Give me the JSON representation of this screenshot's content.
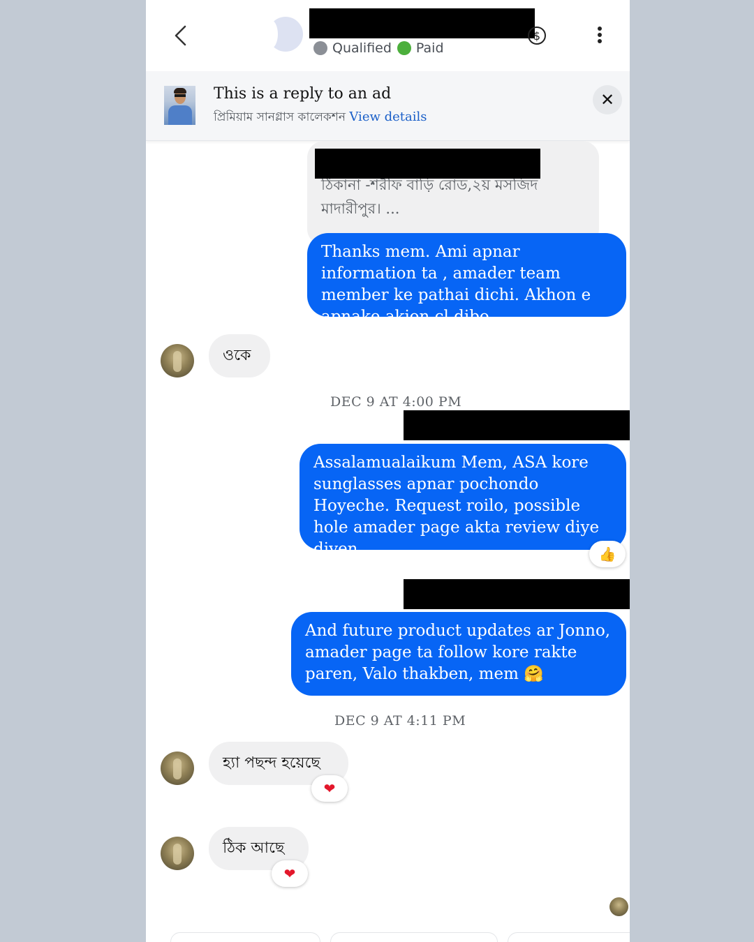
{
  "header": {
    "status": [
      {
        "label": "Qualified",
        "color": "#8b8f96"
      },
      {
        "label": "Paid",
        "color": "#4caf3c"
      }
    ],
    "icons": [
      "back-arrow-icon",
      "dollar-icon",
      "more-vertical-icon"
    ]
  },
  "ad": {
    "title": "This is a reply to an ad",
    "subtitle": "প্রিমিয়াম সানগ্লাস কালেকশন",
    "link": "View details",
    "close": "✕"
  },
  "messages": {
    "quoted_text": "ঠিকানা -শরীফ বাড়ি রোড,২য় মসজিদ মাদারীপুর। ...",
    "out1": "Thanks mem. Ami apnar information ta , amader team member ke pathai dichi. Akhon e apnake akjon cl dibo",
    "in1": "ওকে",
    "time1": "DEC 9 AT 4:00 PM",
    "out2": "Assalamualaikum Mem, ASA kore sunglasses apnar pochondo Hoyeche. Request roilo, possible hole amader page akta review diye diyen.",
    "out2_reaction": "👍",
    "out3": "And future product updates ar Jonno, amader page ta follow kore rakte paren, Valo thakben, mem",
    "out3_emoji": "🤗",
    "time2": "DEC 9 AT 4:11 PM",
    "in2": "হ্যা পছন্দ হয়েছে",
    "in2_reaction": "❤",
    "in3": "ঠিক আছে",
    "in3_reaction": "❤"
  },
  "colors": {
    "outgoing_bubble": "#0765f5",
    "incoming_bubble": "#f0f0f1",
    "link": "#1a5fc8"
  }
}
